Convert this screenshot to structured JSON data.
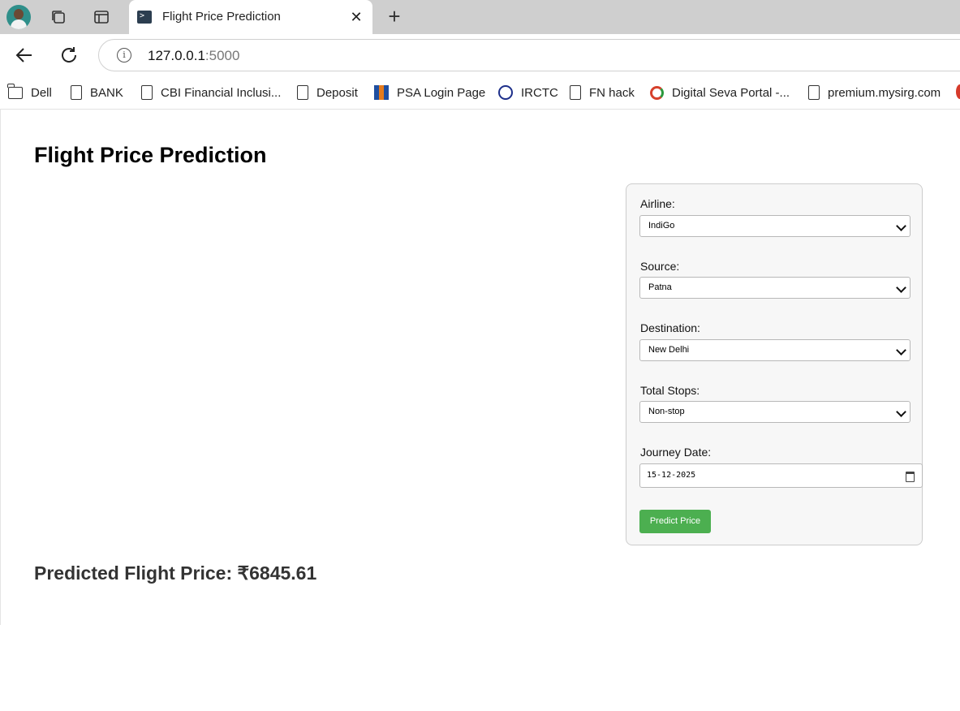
{
  "browser": {
    "tab_title": "Flight Price Prediction",
    "url_host": "127.0.0.1",
    "url_port": ":5000",
    "bookmarks": [
      {
        "label": "Dell",
        "icon": "folder-icon"
      },
      {
        "label": "BANK",
        "icon": "page-icon"
      },
      {
        "label": "CBI Financial Inclusi...",
        "icon": "page-icon"
      },
      {
        "label": "Deposit",
        "icon": "page-icon"
      },
      {
        "label": "PSA Login Page",
        "icon": "psa-icon"
      },
      {
        "label": "IRCTC",
        "icon": "irctc-icon"
      },
      {
        "label": "FN hack",
        "icon": "page-icon"
      },
      {
        "label": "Digital Seva Portal -...",
        "icon": "digital-seva-icon"
      },
      {
        "label": "premium.mysirg.com",
        "icon": "page-icon"
      }
    ]
  },
  "page": {
    "title": "Flight Price Prediction",
    "form": {
      "airline": {
        "label": "Airline:",
        "value": "IndiGo"
      },
      "source": {
        "label": "Source:",
        "value": "Patna"
      },
      "destination": {
        "label": "Destination:",
        "value": "New Delhi"
      },
      "stops": {
        "label": "Total Stops:",
        "value": "Non-stop"
      },
      "date": {
        "label": "Journey Date:",
        "value": "15-12-2025"
      },
      "submit_label": "Predict Price"
    },
    "result": "Predicted Flight Price: ₹6845.61"
  },
  "colors": {
    "button": "#4caf50",
    "card_bg": "#f7f7f7",
    "tab_strip": "#cfcfcf"
  }
}
